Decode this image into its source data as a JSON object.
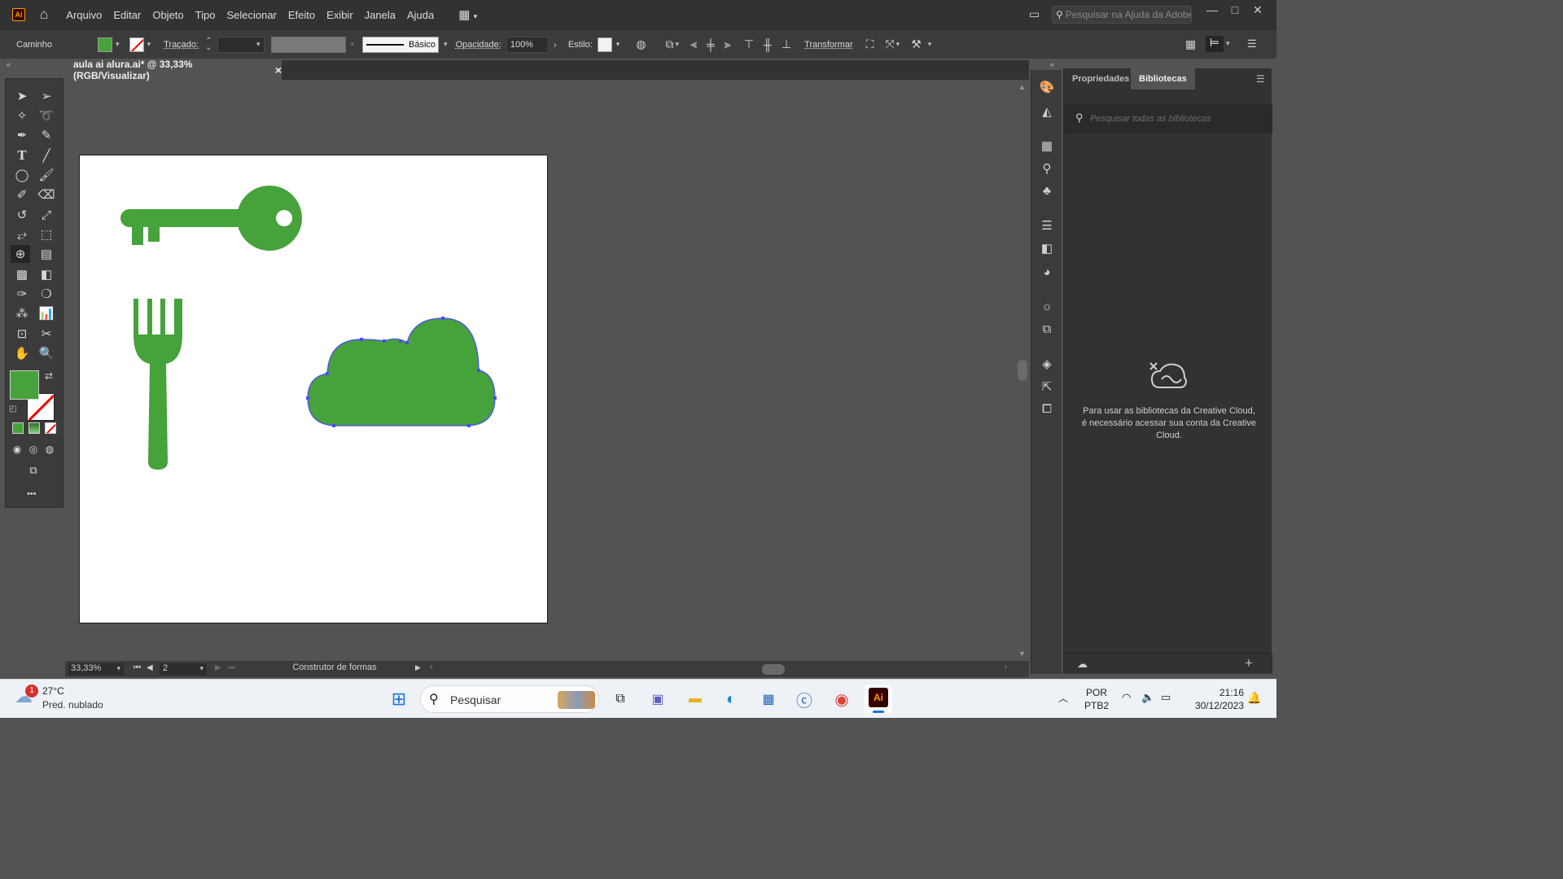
{
  "menubar": {
    "logo": "Ai",
    "items": [
      "Arquivo",
      "Editar",
      "Objeto",
      "Tipo",
      "Selecionar",
      "Efeito",
      "Exibir",
      "Janela",
      "Ajuda"
    ],
    "search_placeholder": "Pesquisar na Ajuda da Adobe"
  },
  "controlbar": {
    "object_type": "Caminho",
    "fill_color": "#46a23a",
    "stroke_label": "Traçado:",
    "brush_label": "Básico",
    "opacity_label": "Opacidade:",
    "opacity_value": "100%",
    "style_label": "Estilo:",
    "transform_label": "Transformar"
  },
  "document": {
    "tab_title": "aula ai alura.ai* @ 33,33% (RGB/Visualizar)",
    "close_glyph": "×"
  },
  "statusbar": {
    "zoom": "33,33%",
    "artboard_number": "2",
    "tool_name": "Construtor de formas"
  },
  "toolpanel": {
    "fill_color": "#46a23a",
    "more_glyph": "•••"
  },
  "artwork": {
    "color": "#46a23a",
    "selection_color": "#4b4bff"
  },
  "rightpanel": {
    "tabs": [
      "Propriedades",
      "Bibliotecas"
    ],
    "search_placeholder": "Pesquisar todas as bibliotecas",
    "message": "Para usar as bibliotecas da Creative Cloud, é necessário acessar sua conta da Creative Cloud."
  },
  "taskbar": {
    "weather_temp": "27°C",
    "weather_desc": "Pred. nublado",
    "weather_badge": "1",
    "search_label": "Pesquisar",
    "lang_line1": "POR",
    "lang_line2": "PTB2",
    "time": "21:16",
    "date": "30/12/2023"
  }
}
